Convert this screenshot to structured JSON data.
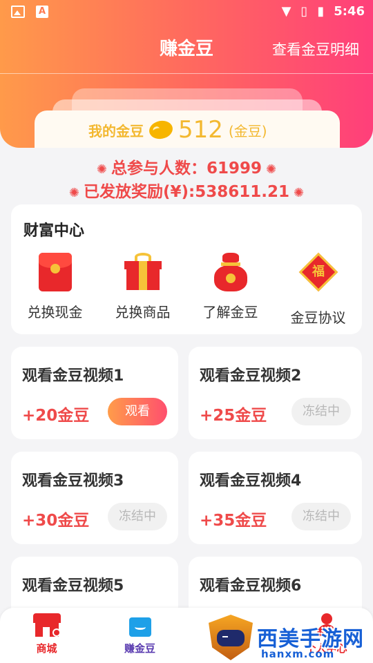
{
  "status_bar": {
    "time": "5:46"
  },
  "header": {
    "title": "赚金豆",
    "detail_link": "查看金豆明细"
  },
  "coins": {
    "label": "我的金豆",
    "amount": "512",
    "unit": "(金豆)"
  },
  "stats": {
    "participants": "总参与人数：61999",
    "rewards_paid": "已发放奖励(¥):538611.21"
  },
  "wealth_center": {
    "title": "财富中心",
    "items": [
      {
        "label": "兑换现金",
        "icon": "red-envelope-icon"
      },
      {
        "label": "兑换商品",
        "icon": "gift-box-icon"
      },
      {
        "label": "了解金豆",
        "icon": "money-bag-icon"
      },
      {
        "label": "金豆协议",
        "icon": "fortune-diamond-icon",
        "glyph": "福"
      }
    ]
  },
  "videos": [
    {
      "title": "观看金豆视频1",
      "reward": "+20金豆",
      "button": "观看",
      "state": "active"
    },
    {
      "title": "观看金豆视频2",
      "reward": "+25金豆",
      "button": "冻结中",
      "state": "frozen"
    },
    {
      "title": "观看金豆视频3",
      "reward": "+30金豆",
      "button": "冻结中",
      "state": "frozen"
    },
    {
      "title": "观看金豆视频4",
      "reward": "+35金豆",
      "button": "冻结中",
      "state": "frozen"
    },
    {
      "title": "观看金豆视频5"
    },
    {
      "title": "观看金豆视频6"
    }
  ],
  "tabbar": [
    {
      "label": "商城",
      "color": "#e8282b"
    },
    {
      "label": "赚金豆",
      "color": "#5a3bb0"
    },
    {
      "label": "",
      "color": "#e8282b"
    },
    {
      "label": "个人中心",
      "color": "#e8282b"
    }
  ],
  "watermark": {
    "brand": "西美手游网",
    "url": "hanxm.com"
  },
  "colors": {
    "accent_start": "#ff9a4a",
    "accent_end": "#ff3f7a",
    "reward_red": "#ef4a4a",
    "gold": "#f3b830"
  }
}
